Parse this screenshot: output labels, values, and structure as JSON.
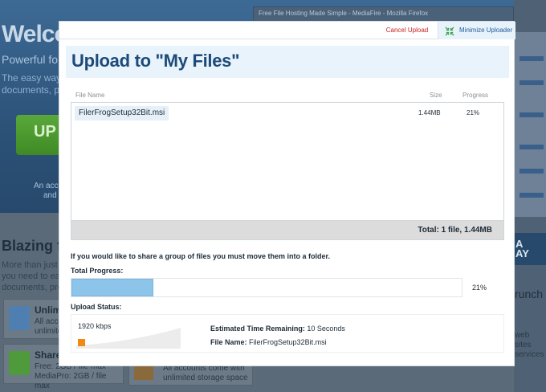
{
  "background_page": {
    "hero_title": "Welco",
    "hero_subtitle": "Powerful fo",
    "hero_line1": "The easy way",
    "hero_line2": "documents, pr",
    "upload_button": "UP",
    "hero_small1": "An acco",
    "hero_small2": "and",
    "section_title": "Blazing f",
    "section_line1": "More than just a",
    "section_line2": "you need to ea",
    "section_line3": "documents, pre",
    "feature1_title": "Unlimi",
    "feature1_text1": "All acco",
    "feature1_text2": "unlimite",
    "feature2_title": "Share",
    "feature2_text1": "Free: 2GB / file max",
    "feature2_text2": "MediaPro: 2GB / file max",
    "feature3_text1": "All accounts come with",
    "feature3_text2": "unlimited storage space",
    "right_logo": "A\nAY",
    "right_text": "runch",
    "right_text2a": "web sites",
    "right_text2b": "services",
    "browser_title": "Free File Hosting Made Simple - MediaFire - Mozilla Firefox"
  },
  "dialog": {
    "cancel_label": "Cancel Upload",
    "minimize_label": "Minimize Uploader",
    "minimize_icon": "compress-arrows-icon",
    "title": "Upload to \"My Files\"",
    "columns": {
      "name": "File Name",
      "size": "Size",
      "progress": "Progress"
    },
    "files": [
      {
        "name": "FilerFrogSetup32Bit.msi",
        "size": "1.44MB",
        "progress": "21%"
      }
    ],
    "total_summary": "Total: 1 file, 1.44MB",
    "share_note": "If you would like to share a group of files you must move them into a folder.",
    "total_progress_label": "Total Progress:",
    "total_progress_value": 21,
    "total_progress_text": "21%",
    "upload_status_label": "Upload Status:",
    "speed": "1920 kbps",
    "eta_label": "Estimated Time Remaining:",
    "eta_value": "10 Seconds",
    "file_name_label": "File Name:",
    "file_name_value": "FilerFrogSetup32Bit.msi",
    "colors": {
      "accent": "#1d4a78",
      "progress_fill": "#8cc4ea",
      "cancel": "#cc2020",
      "speed_marker": "#f08a14"
    }
  }
}
